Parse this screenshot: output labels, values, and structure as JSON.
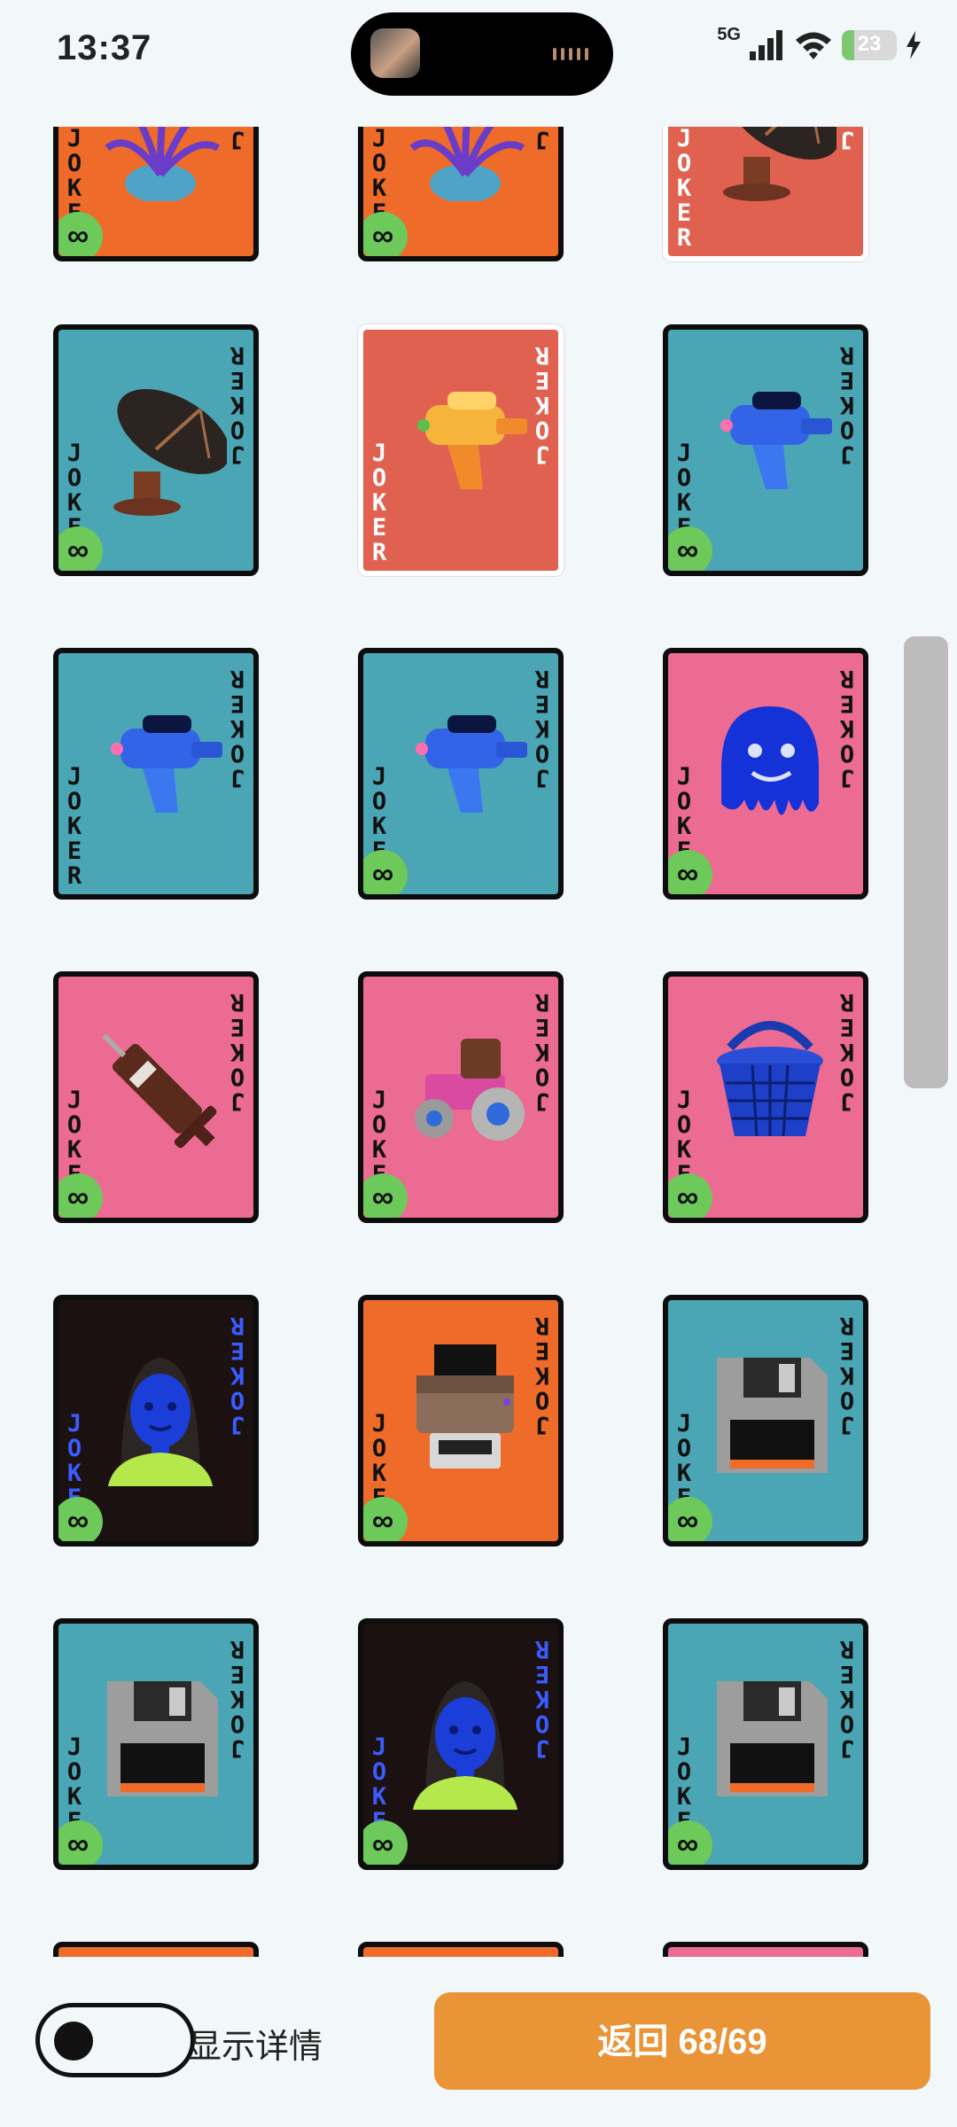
{
  "status_bar": {
    "time": "13:37",
    "network": "5G",
    "battery": "23",
    "battery_level_percent": 23,
    "icons": [
      "signal-icon",
      "wifi-icon",
      "battery-icon",
      "charging-icon"
    ]
  },
  "cards": {
    "corner_text": "JOKER",
    "badge_symbol": "∞",
    "items": [
      {
        "art": "plant-pot",
        "background": "#ef6b2a",
        "border": "#0d0d0d",
        "has_badge": true
      },
      {
        "art": "plant-pot",
        "background": "#ef6b2a",
        "border": "#0d0d0d",
        "has_badge": true
      },
      {
        "art": "satellite-dish",
        "background": "#e06150",
        "border": "#ffffff",
        "has_badge": false
      },
      {
        "art": "satellite-dish",
        "background": "#4aa6b5",
        "border": "#0d0d0d",
        "has_badge": true
      },
      {
        "art": "water-gun-orange",
        "background": "#e06150",
        "border": "#ffffff",
        "has_badge": false
      },
      {
        "art": "water-gun-blue",
        "background": "#4aa6b5",
        "border": "#0d0d0d",
        "has_badge": true
      },
      {
        "art": "water-gun-blue",
        "background": "#4aa6b5",
        "border": "#0d0d0d",
        "has_badge": false
      },
      {
        "art": "water-gun-blue",
        "background": "#4aa6b5",
        "border": "#0d0d0d",
        "has_badge": true
      },
      {
        "art": "slime-face",
        "background": "#ec6b92",
        "border": "#0d0d0d",
        "has_badge": true
      },
      {
        "art": "syringe",
        "background": "#ec6b92",
        "border": "#0d0d0d",
        "has_badge": true
      },
      {
        "art": "tractor",
        "background": "#ec6b92",
        "border": "#0d0d0d",
        "has_badge": true
      },
      {
        "art": "basket",
        "background": "#ec6b92",
        "border": "#0d0d0d",
        "has_badge": true
      },
      {
        "art": "woman-portrait",
        "background": "#1a1110",
        "border": "#0d0d0d",
        "has_badge": true
      },
      {
        "art": "printer",
        "background": "#ef6b2a",
        "border": "#0d0d0d",
        "has_badge": true
      },
      {
        "art": "floppy-disk",
        "background": "#4aa6b5",
        "border": "#0d0d0d",
        "has_badge": true
      },
      {
        "art": "floppy-disk",
        "background": "#4aa6b5",
        "border": "#0d0d0d",
        "has_badge": true
      },
      {
        "art": "woman-portrait",
        "background": "#1a1110",
        "border": "#0d0d0d",
        "has_badge": true
      },
      {
        "art": "floppy-disk",
        "background": "#4aa6b5",
        "border": "#0d0d0d",
        "has_badge": true
      },
      {
        "art": "partial",
        "background": "#ef6b2a",
        "border": "#0d0d0d",
        "has_badge": false
      },
      {
        "art": "partial",
        "background": "#ef6b2a",
        "border": "#0d0d0d",
        "has_badge": false
      },
      {
        "art": "partial",
        "background": "#ec6b92",
        "border": "#0d0d0d",
        "has_badge": false
      }
    ]
  },
  "bottom_bar": {
    "toggle_label": "显示详情",
    "toggle_on": false,
    "return_button_label": "返回 68/69"
  }
}
